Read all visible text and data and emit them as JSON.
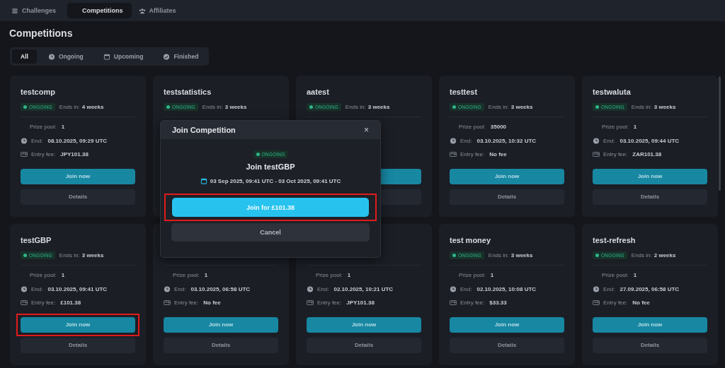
{
  "nav_tabs": [
    {
      "label": "Challenges",
      "kind": "list",
      "selected": false
    },
    {
      "label": "Competitions",
      "kind": "plain",
      "selected": true
    },
    {
      "label": "Affiliates",
      "kind": "people",
      "selected": false
    }
  ],
  "heading": "Competitions",
  "filters": [
    {
      "label": "All",
      "kind": "plain",
      "selected": true
    },
    {
      "label": "Ongoing",
      "kind": "clock",
      "selected": false
    },
    {
      "label": "Upcoming",
      "kind": "calendar",
      "selected": false
    },
    {
      "label": "Finished",
      "kind": "check",
      "selected": false
    }
  ],
  "cards": [
    {
      "title": "testcomp",
      "status": "ONGOING",
      "ends_label": "Ends in:",
      "ends_in": "4 weeks",
      "prize_label": "Prize pool:",
      "prize": "1",
      "end_label": "End:",
      "end": "08.10.2025, 09:29 UTC",
      "fee_label": "Entry fee:",
      "fee": "JPY101.38",
      "join": "Join now",
      "details": "Details",
      "highlighted": false
    },
    {
      "kind": "header_only",
      "title": "teststatistics",
      "status": "ONGOING",
      "ends_label": "Ends in:",
      "ends_in": "3 weeks"
    },
    {
      "kind": "header_and_buttons",
      "title": "aatest",
      "status": "ONGOING",
      "ends_label": "Ends in:",
      "ends_in": "3 weeks",
      "highlighted": false
    },
    {
      "title": "testtest",
      "status": "ONGOING",
      "ends_label": "Ends in:",
      "ends_in": "3 weeks",
      "prize_label": "Prize pool:",
      "prize": "35000",
      "end_label": "End:",
      "end": "03.10.2025, 10:32 UTC",
      "fee_label": "Entry fee:",
      "fee": "No fee",
      "join": "Join now",
      "details": "Details",
      "highlighted": false
    },
    {
      "title": "testwaluta",
      "status": "ONGOING",
      "ends_label": "Ends in:",
      "ends_in": "3 weeks",
      "prize_label": "Prize pool:",
      "prize": "1",
      "end_label": "End:",
      "end": "03.10.2025, 09:44 UTC",
      "fee_label": "Entry fee:",
      "fee": "ZAR101.38",
      "join": "Join now",
      "details": "Details",
      "highlighted": false
    },
    {
      "title": "testGBP",
      "status": "ONGOING",
      "ends_label": "Ends in:",
      "ends_in": "3 weeks",
      "prize_label": "Prize pool:",
      "prize": "1",
      "end_label": "End:",
      "end": "03.10.2025, 09:41 UTC",
      "fee_label": "Entry fee:",
      "fee": "£101.38",
      "join": "Join now",
      "details": "Details",
      "highlighted": true
    },
    {
      "prize_label": "Prize pool:",
      "prize": "1",
      "end_label": "End:",
      "end": "03.10.2025, 06:58 UTC",
      "fee_label": "Entry fee:",
      "fee": "No fee",
      "join": "Join now",
      "details": "Details",
      "highlighted": false
    },
    {
      "prize_label": "Prize pool:",
      "prize": "1",
      "end_label": "End:",
      "end": "02.10.2025, 10:21 UTC",
      "fee_label": "Entry fee:",
      "fee": "JPY101.38",
      "join": "Join now",
      "details": "Details",
      "highlighted": false
    },
    {
      "title": "test money",
      "status": "ONGOING",
      "ends_label": "Ends in:",
      "ends_in": "3 weeks",
      "prize_label": "Prize pool:",
      "prize": "1",
      "end_label": "End:",
      "end": "02.10.2025, 10:08 UTC",
      "fee_label": "Entry fee:",
      "fee": "$33.33",
      "join": "Join now",
      "details": "Details",
      "highlighted": false
    },
    {
      "title": "test-refresh",
      "status": "ONGOING",
      "ends_label": "Ends in:",
      "ends_in": "2 weeks",
      "prize_label": "Prize pool:",
      "prize": "1",
      "end_label": "End:",
      "end": "27.09.2025, 06:58 UTC",
      "fee_label": "Entry fee:",
      "fee": "No fee",
      "join": "Join now",
      "details": "Details",
      "highlighted": false
    }
  ],
  "modal": {
    "title": "Join Competition",
    "close": "×",
    "status": "ONGOING",
    "heading": "Join testGBP",
    "dates": "03 Sep 2025, 09:41 UTC - 03 Oct 2025, 09:41 UTC",
    "confirm": "Join for £101.38",
    "confirm_highlighted": true,
    "cancel": "Cancel"
  }
}
